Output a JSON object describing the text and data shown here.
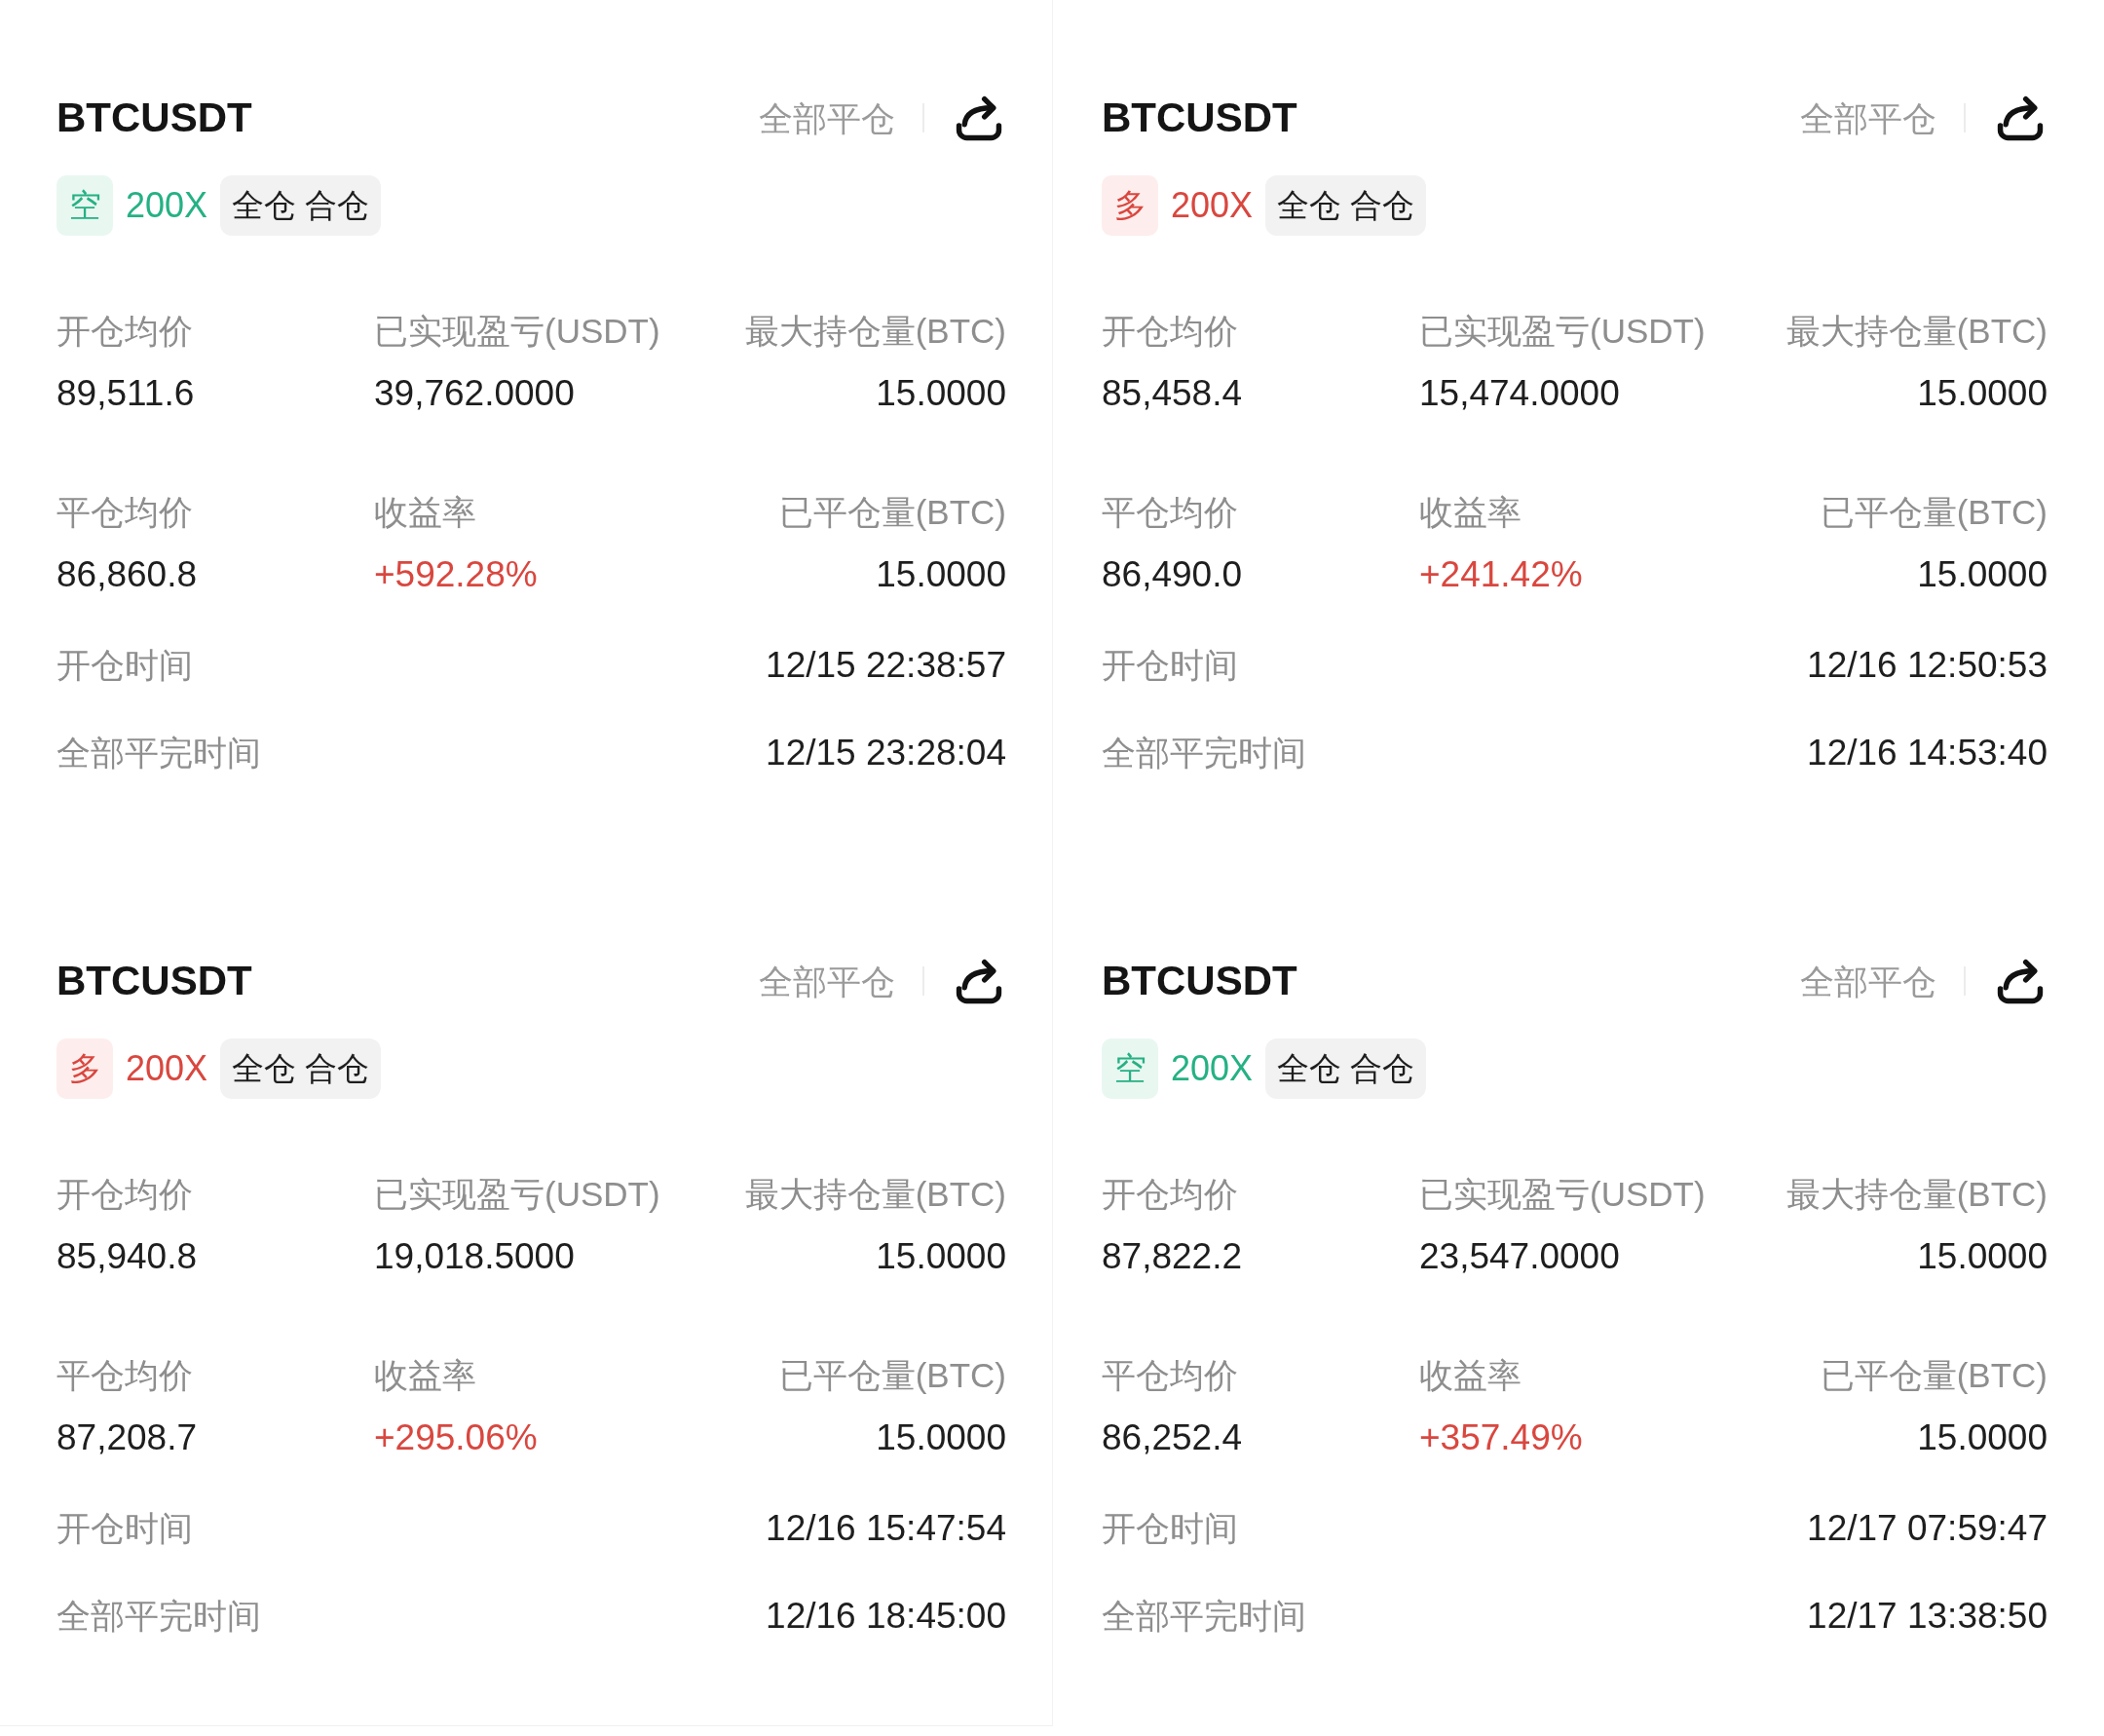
{
  "cards": [
    {
      "symbol": "BTCUSDT",
      "close_all": "全部平仓",
      "side": {
        "label": "空",
        "kind": "short"
      },
      "leverage": "200X",
      "margin_mode": "全仓 合仓",
      "stats": [
        {
          "label": "开仓均价",
          "value": "89,511.6",
          "kind": "plain"
        },
        {
          "label": "已实现盈亏(USDT)",
          "value": "39,762.0000",
          "kind": "plain"
        },
        {
          "label": "最大持仓量(BTC)",
          "value": "15.0000",
          "kind": "plain"
        },
        {
          "label": "平仓均价",
          "value": "86,860.8",
          "kind": "plain"
        },
        {
          "label": "收益率",
          "value": "+592.28%",
          "kind": "gain"
        },
        {
          "label": "已平仓量(BTC)",
          "value": "15.0000",
          "kind": "plain"
        }
      ],
      "times": [
        {
          "label": "开仓时间",
          "value": "12/15 22:38:57"
        },
        {
          "label": "全部平完时间",
          "value": "12/15 23:28:04"
        }
      ]
    },
    {
      "symbol": "BTCUSDT",
      "close_all": "全部平仓",
      "side": {
        "label": "多",
        "kind": "long"
      },
      "leverage": "200X",
      "margin_mode": "全仓 合仓",
      "stats": [
        {
          "label": "开仓均价",
          "value": "85,458.4",
          "kind": "plain"
        },
        {
          "label": "已实现盈亏(USDT)",
          "value": "15,474.0000",
          "kind": "plain"
        },
        {
          "label": "最大持仓量(BTC)",
          "value": "15.0000",
          "kind": "plain"
        },
        {
          "label": "平仓均价",
          "value": "86,490.0",
          "kind": "plain"
        },
        {
          "label": "收益率",
          "value": "+241.42%",
          "kind": "gain"
        },
        {
          "label": "已平仓量(BTC)",
          "value": "15.0000",
          "kind": "plain"
        }
      ],
      "times": [
        {
          "label": "开仓时间",
          "value": "12/16 12:50:53"
        },
        {
          "label": "全部平完时间",
          "value": "12/16 14:53:40"
        }
      ]
    },
    {
      "symbol": "BTCUSDT",
      "close_all": "全部平仓",
      "side": {
        "label": "多",
        "kind": "long"
      },
      "leverage": "200X",
      "margin_mode": "全仓 合仓",
      "stats": [
        {
          "label": "开仓均价",
          "value": "85,940.8",
          "kind": "plain"
        },
        {
          "label": "已实现盈亏(USDT)",
          "value": "19,018.5000",
          "kind": "plain"
        },
        {
          "label": "最大持仓量(BTC)",
          "value": "15.0000",
          "kind": "plain"
        },
        {
          "label": "平仓均价",
          "value": "87,208.7",
          "kind": "plain"
        },
        {
          "label": "收益率",
          "value": "+295.06%",
          "kind": "gain"
        },
        {
          "label": "已平仓量(BTC)",
          "value": "15.0000",
          "kind": "plain"
        }
      ],
      "times": [
        {
          "label": "开仓时间",
          "value": "12/16 15:47:54"
        },
        {
          "label": "全部平完时间",
          "value": "12/16 18:45:00"
        }
      ]
    },
    {
      "symbol": "BTCUSDT",
      "close_all": "全部平仓",
      "side": {
        "label": "空",
        "kind": "short"
      },
      "leverage": "200X",
      "margin_mode": "全仓 合仓",
      "stats": [
        {
          "label": "开仓均价",
          "value": "87,822.2",
          "kind": "plain"
        },
        {
          "label": "已实现盈亏(USDT)",
          "value": "23,547.0000",
          "kind": "plain"
        },
        {
          "label": "最大持仓量(BTC)",
          "value": "15.0000",
          "kind": "plain"
        },
        {
          "label": "平仓均价",
          "value": "86,252.4",
          "kind": "plain"
        },
        {
          "label": "收益率",
          "value": "+357.49%",
          "kind": "gain"
        },
        {
          "label": "已平仓量(BTC)",
          "value": "15.0000",
          "kind": "plain"
        }
      ],
      "times": [
        {
          "label": "开仓时间",
          "value": "12/17 07:59:47"
        },
        {
          "label": "全部平完时间",
          "value": "12/17 13:38:50"
        }
      ]
    }
  ]
}
